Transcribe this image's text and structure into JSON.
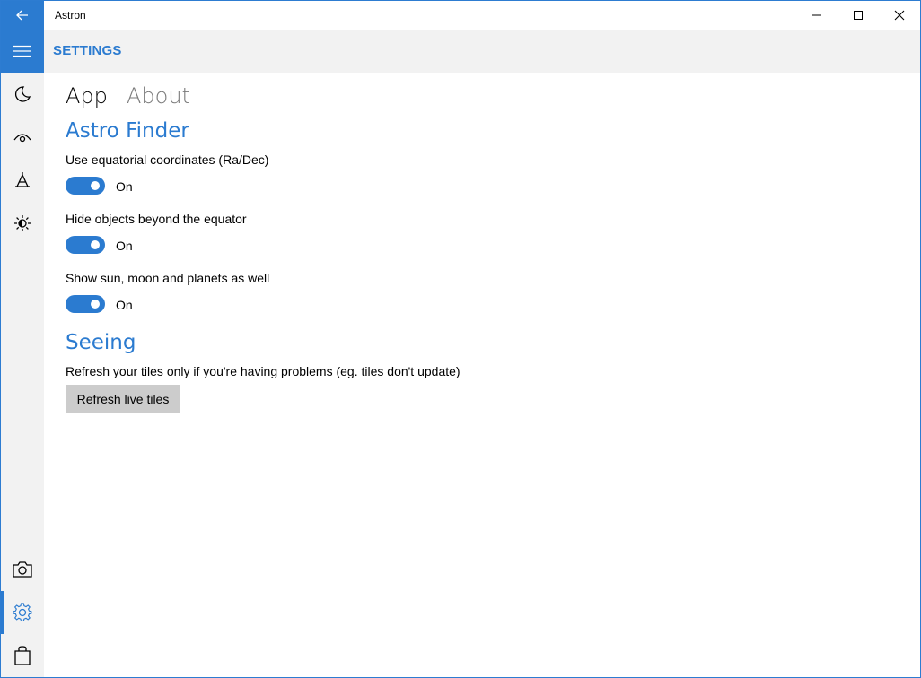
{
  "window": {
    "title": "Astron"
  },
  "header": {
    "title": "SETTINGS"
  },
  "sidebar": {
    "items": [
      {
        "icon": "moon-icon"
      },
      {
        "icon": "eye-icon"
      },
      {
        "icon": "telescope-icon"
      },
      {
        "icon": "sun-icon"
      },
      {
        "icon": "camera-icon"
      },
      {
        "icon": "gear-icon",
        "active": true
      },
      {
        "icon": "shopping-bag-icon"
      }
    ]
  },
  "tabs": {
    "app": "App",
    "about": "About"
  },
  "astro_finder": {
    "title": "Astro Finder",
    "settings": [
      {
        "label": "Use equatorial coordinates (Ra/Dec)",
        "state": "On"
      },
      {
        "label": "Hide objects beyond the equator",
        "state": "On"
      },
      {
        "label": "Show sun, moon and planets as well",
        "state": "On"
      }
    ]
  },
  "seeing": {
    "title": "Seeing",
    "description": "Refresh your tiles only if you're having problems (eg. tiles don't update)",
    "button_label": "Refresh live tiles"
  },
  "colors": {
    "accent": "#2b7bd0",
    "sidebar_bg": "#f2f2f2",
    "button_bg": "#cccccc"
  }
}
